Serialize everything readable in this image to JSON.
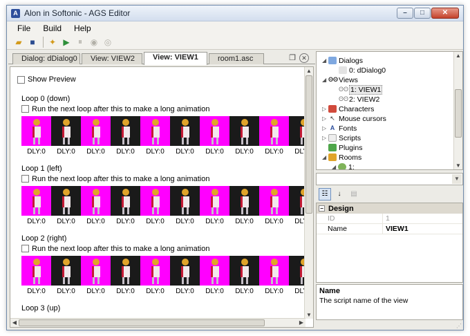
{
  "window": {
    "title": "Alon in Softonic - AGS Editor",
    "minimize": "–",
    "maximize": "□",
    "close": "✕"
  },
  "menu": [
    "File",
    "Build",
    "Help"
  ],
  "tabs": [
    {
      "label": "Dialog: dDialog0",
      "active": false
    },
    {
      "label": "View: VIEW2",
      "active": false
    },
    {
      "label": "View: VIEW1",
      "active": true
    },
    {
      "label": "room1.asc",
      "active": false
    }
  ],
  "editor": {
    "show_preview": "Show Preview",
    "loops": [
      {
        "title": "Loop 0 (down)",
        "check": "Run the next loop after this to make a long animation"
      },
      {
        "title": "Loop 1 (left)",
        "check": "Run the next loop after this to make a long animation"
      },
      {
        "title": "Loop 2 (right)",
        "check": "Run the next loop after this to make a long animation"
      },
      {
        "title": "Loop 3 (up)"
      }
    ],
    "delay_label": "DLY:0",
    "frames_per_loop": 10
  },
  "tree": {
    "dialogs": "Dialogs",
    "dialog0": "0: dDialog0",
    "views": "Views",
    "view1": "1: VIEW1",
    "view2": "2: VIEW2",
    "characters": "Characters",
    "mouse_cursors": "Mouse cursors",
    "fonts": "Fonts",
    "scripts": "Scripts",
    "plugins": "Plugins",
    "rooms": "Rooms",
    "room1": "1:"
  },
  "properties": {
    "category": "Design",
    "rows": [
      {
        "name": "ID",
        "value": "1",
        "readonly": true
      },
      {
        "name": "Name",
        "value": "VIEW1",
        "readonly": false
      }
    ]
  },
  "description": {
    "title": "Name",
    "text": "The script name of the view"
  },
  "colors": {
    "transparent_magenta": "#ff00ff",
    "accent": "#2d4e9c"
  }
}
